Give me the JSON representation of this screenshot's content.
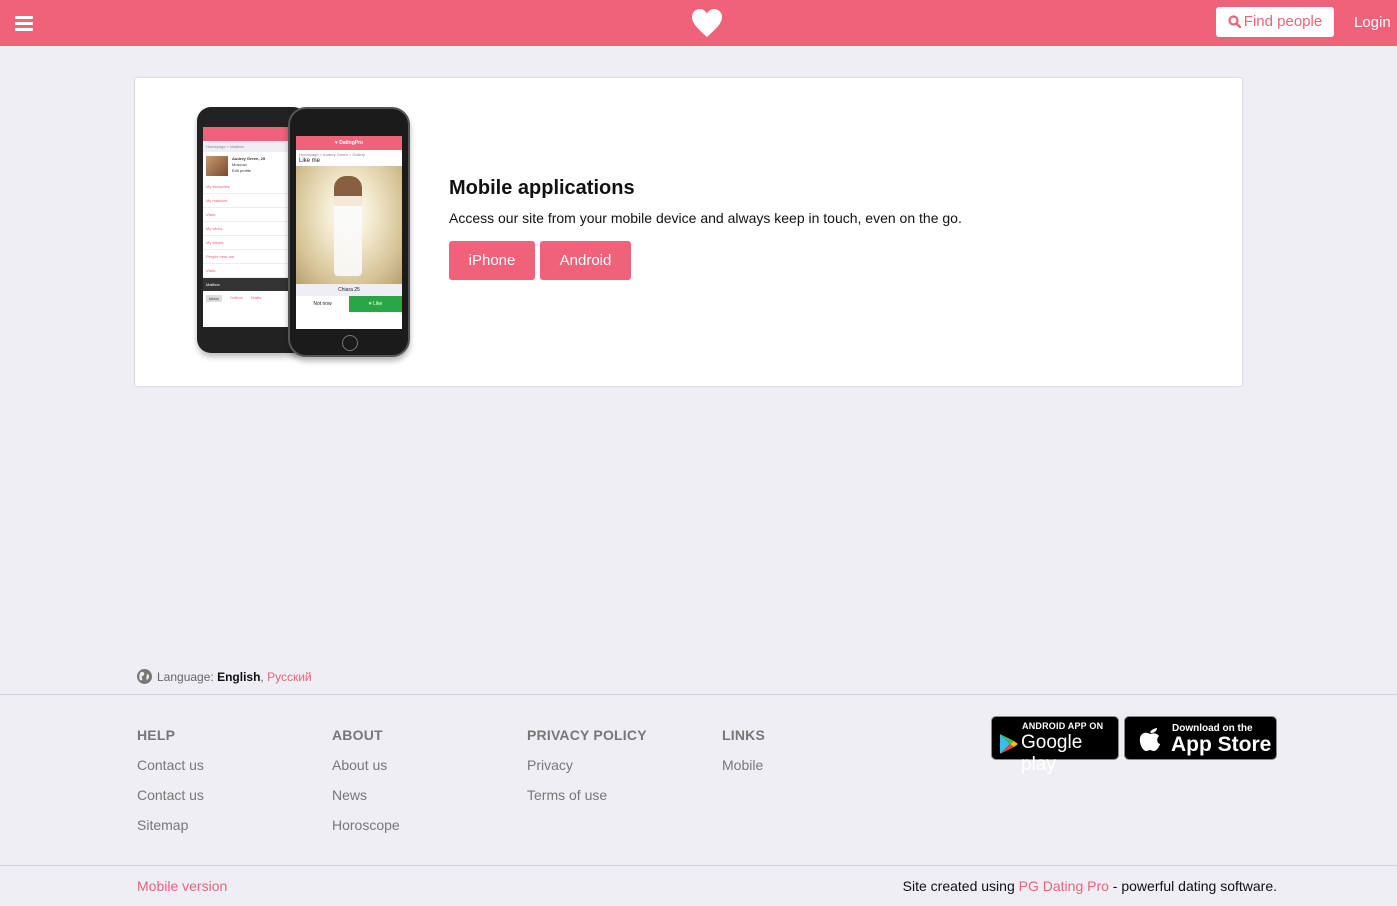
{
  "header": {
    "find_people_label": "Find people",
    "login_label": "Login",
    "brand_color": "#f0617a"
  },
  "promo": {
    "title": "Mobile applications",
    "description": "Access our site from your mobile device and always keep in touch, even on the go.",
    "buttons": {
      "iphone": "iPhone",
      "android": "Android"
    },
    "mockup": {
      "android": {
        "breadcrumb": "Homepage > Mailbox",
        "profile_name": "Audrey Green, 25",
        "profile_city": "Moscow",
        "profile_edit": "Edit profile",
        "menu": [
          "My favourites",
          "My matches",
          "Visits",
          "My winks",
          "My kisses",
          "People near me",
          "Visits"
        ],
        "mailbox": "Mailbox",
        "tabs": [
          "Inbox",
          "Outbox",
          "Drafts"
        ]
      },
      "iphone": {
        "brand": "♥ DatingPro",
        "breadcrumb": "Homepage > Audrey Green > Gallery",
        "section": "Like me",
        "person": "Chiara 25",
        "not_now": "Not now",
        "like": "♥ Like"
      }
    }
  },
  "language": {
    "label": "Language:",
    "current": "English",
    "separator": ",",
    "other": "Русский"
  },
  "footer": {
    "columns": [
      {
        "title": "HELP",
        "links": [
          "Contact us",
          "Contact us",
          "Sitemap"
        ]
      },
      {
        "title": "ABOUT",
        "links": [
          "About us",
          "News",
          "Horoscope"
        ]
      },
      {
        "title": "PRIVACY POLICY",
        "links": [
          "Privacy",
          "Terms of use"
        ]
      },
      {
        "title": "LINKS",
        "links": [
          "Mobile"
        ]
      }
    ],
    "google_play": {
      "small": "ANDROID APP ON",
      "large": "Google play"
    },
    "app_store": {
      "small": "Download on the",
      "large": "App Store"
    },
    "mobile_version": "Mobile version",
    "credit_prefix": "Site created using ",
    "credit_link": "PG Dating Pro",
    "credit_suffix": " - powerful dating software."
  }
}
